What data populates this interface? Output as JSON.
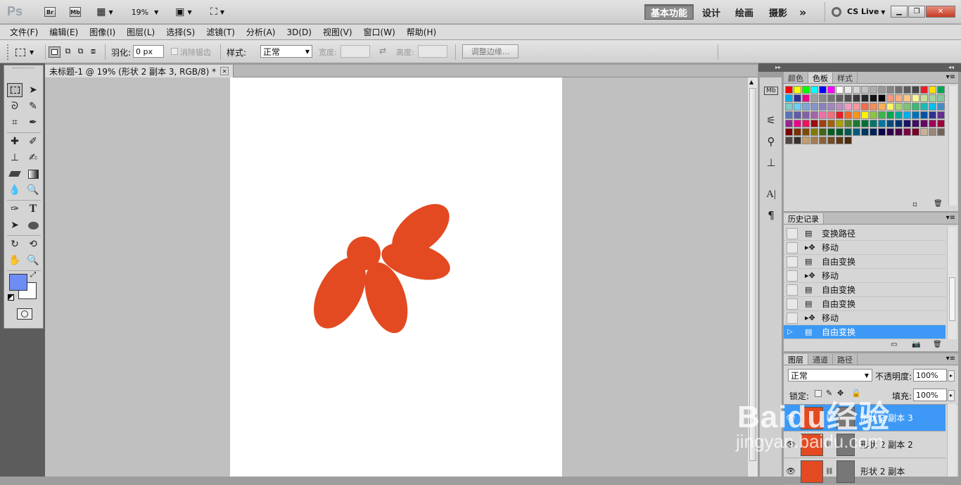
{
  "app": {
    "logo": "Ps"
  },
  "titlebar": {
    "br_label": "Br",
    "mb_label": "Mb",
    "zoom": "19%",
    "workspaces": [
      "基本功能",
      "设计",
      "绘画",
      "摄影"
    ],
    "more": "»",
    "cslive": "CS Live"
  },
  "menu": [
    "文件(F)",
    "编辑(E)",
    "图像(I)",
    "图层(L)",
    "选择(S)",
    "滤镜(T)",
    "分析(A)",
    "3D(D)",
    "视图(V)",
    "窗口(W)",
    "帮助(H)"
  ],
  "options": {
    "feather_label": "羽化:",
    "feather_value": "0 px",
    "antialias_label": "消除锯齿",
    "style_label": "样式:",
    "style_value": "正常",
    "width_label": "宽度:",
    "height_label": "高度:",
    "refine_edge": "调整边缘..."
  },
  "document": {
    "tab_title": "未标题-1 @ 19% (形状 2 副本 3, RGB/8) *",
    "shape_color": "#e34a21"
  },
  "colors": {
    "foreground": "#6d8df5",
    "background": "#ffffff"
  },
  "swatches_panel": {
    "tabs": [
      "颜色",
      "色板",
      "样式"
    ],
    "active_tab": "色板",
    "rows": [
      [
        "#ff0000",
        "#ffff00",
        "#00ff00",
        "#00ffff",
        "#0000ff",
        "#ff00ff",
        "#ffffff",
        "#ebebeb",
        "#d6d6d6",
        "#c2c2c2",
        "#adadad",
        "#999999",
        "#858585",
        "#707070",
        "#5c5c5c",
        "#474747",
        "#ed1c24",
        "#ffde00",
        "#00a651"
      ],
      [
        "#00aeef",
        "#2e3192",
        "#ec008c",
        "#9e9e9e",
        "#8a8a8a",
        "#757575",
        "#616161",
        "#4d4d4d",
        "#393939",
        "#262626",
        "#141414",
        "#000000",
        "#f7977a",
        "#f9ad81",
        "#fdc68a",
        "#fff79a",
        "#c4df9b",
        "#a2d39c",
        "#82ca9d"
      ],
      [
        "#7bcdc8",
        "#6ecff6",
        "#7ea7d8",
        "#8493ca",
        "#8882be",
        "#a187be",
        "#bc8dbf",
        "#f49ac2",
        "#f6989d",
        "#f26c4f",
        "#f68e55",
        "#fbaf5c",
        "#fff467",
        "#acd373",
        "#7cc576",
        "#3bb878",
        "#1abbb4",
        "#00bff3",
        "#438ccb"
      ],
      [
        "#5674b9",
        "#605ca8",
        "#855fa8",
        "#a763a8",
        "#f06eaa",
        "#f26d7d",
        "#ed1c24",
        "#f26522",
        "#f7941d",
        "#fff200",
        "#8dc63f",
        "#39b54a",
        "#00a651",
        "#00a99d",
        "#00aeef",
        "#0072bc",
        "#0054a6",
        "#2e3192",
        "#662d91"
      ],
      [
        "#92278f",
        "#ec008c",
        "#ed145b",
        "#9e0b0f",
        "#a0410d",
        "#a36209",
        "#aba000",
        "#598527",
        "#197b30",
        "#007236",
        "#00746b",
        "#0076a3",
        "#004b80",
        "#003471",
        "#1b1464",
        "#440e62",
        "#630460",
        "#9e005d",
        "#9e0039"
      ],
      [
        "#790000",
        "#7b2e00",
        "#7d4900",
        "#827b00",
        "#406618",
        "#005e20",
        "#005826",
        "#005952",
        "#005b7f",
        "#003663",
        "#002157",
        "#0d004c",
        "#32004b",
        "#4b0049",
        "#7b0046",
        "#7a0026",
        "#c7b299",
        "#998675",
        "#736357"
      ],
      [
        "#534741",
        "#37302d",
        "#c69c6d",
        "#a67c52",
        "#8c6239",
        "#754c24",
        "#603913",
        "#4a2b10"
      ]
    ]
  },
  "history_panel": {
    "tab": "历史记录",
    "items": [
      {
        "label": "变换路径",
        "icon": "transform-path-icon"
      },
      {
        "label": "移动",
        "icon": "move-icon"
      },
      {
        "label": "自由变换",
        "icon": "free-transform-icon"
      },
      {
        "label": "移动",
        "icon": "move-icon"
      },
      {
        "label": "自由变换",
        "icon": "free-transform-icon"
      },
      {
        "label": "自由变换",
        "icon": "free-transform-icon"
      },
      {
        "label": "移动",
        "icon": "move-icon"
      },
      {
        "label": "自由变换",
        "icon": "free-transform-icon",
        "selected": true
      }
    ]
  },
  "layers_panel": {
    "tabs": [
      "图层",
      "通道",
      "路径"
    ],
    "blend_mode": "正常",
    "opacity_label": "不透明度:",
    "opacity_value": "100%",
    "lock_label": "锁定:",
    "fill_label": "填充:",
    "fill_value": "100%",
    "layers": [
      {
        "name": "形状 2 副本 3",
        "selected": true
      },
      {
        "name": "形状 2 副本 2",
        "selected": false
      },
      {
        "name": "形状 2 副本",
        "selected": false
      }
    ]
  },
  "watermark": {
    "brand": "Baidu经验",
    "url": "jingyan.baidu.com"
  }
}
